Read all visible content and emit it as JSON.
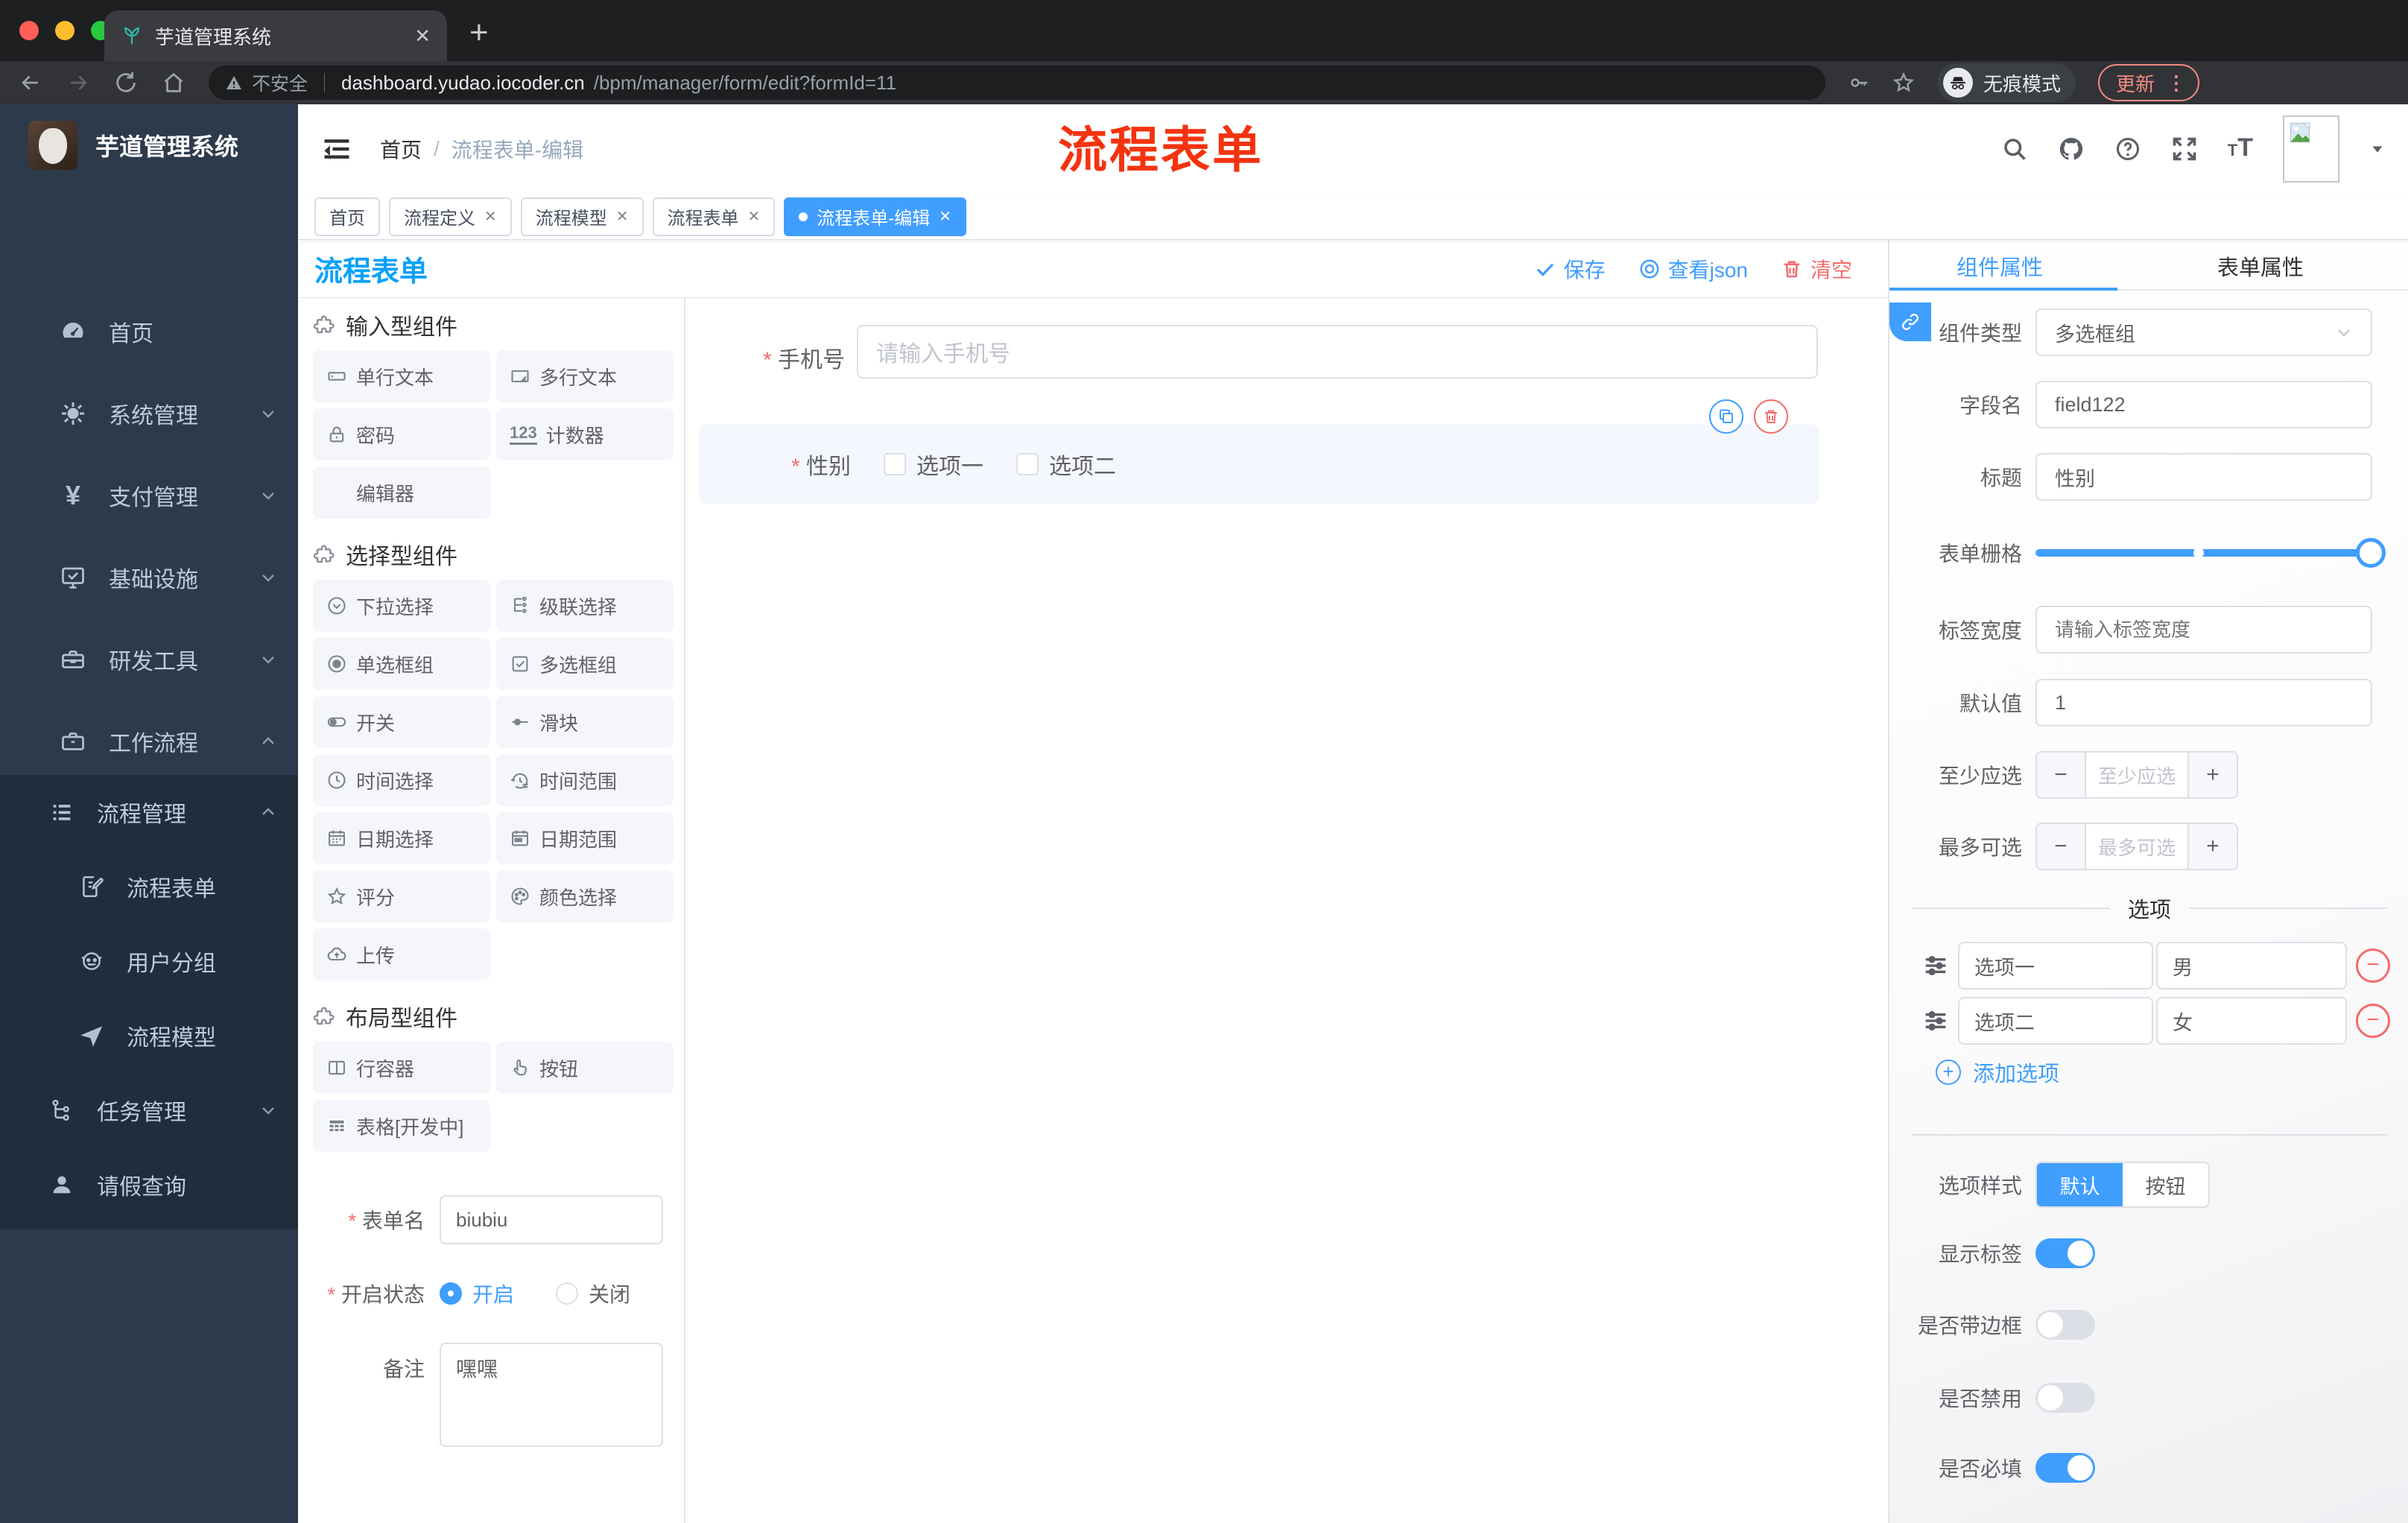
{
  "browser": {
    "tab_title": "芋道管理系统",
    "security_label": "不安全",
    "url_host": "dashboard.yudao.iocoder.cn",
    "url_path": "/bpm/manager/form/edit?formId=11",
    "incognito_label": "无痕模式",
    "update_label": "更新"
  },
  "sidebar": {
    "app_title": "芋道管理系统",
    "items": [
      {
        "label": "首页"
      },
      {
        "label": "系统管理"
      },
      {
        "label": "支付管理"
      },
      {
        "label": "基础设施"
      },
      {
        "label": "研发工具"
      },
      {
        "label": "工作流程"
      }
    ],
    "sub": [
      {
        "label": "流程管理"
      },
      {
        "label": "流程表单"
      },
      {
        "label": "用户分组"
      },
      {
        "label": "流程模型"
      },
      {
        "label": "任务管理"
      },
      {
        "label": "请假查询"
      }
    ]
  },
  "header": {
    "breadcrumb_home": "首页",
    "breadcrumb_sep": "/",
    "breadcrumb_current": "流程表单-编辑",
    "annotation": "流程表单"
  },
  "tags": [
    {
      "label": "首页"
    },
    {
      "label": "流程定义"
    },
    {
      "label": "流程模型"
    },
    {
      "label": "流程表单"
    },
    {
      "label": "流程表单-编辑"
    }
  ],
  "designer": {
    "title": "流程表单",
    "toolbar": {
      "save": "保存",
      "view_json": "查看json",
      "clear": "清空"
    }
  },
  "palette": {
    "sections": [
      {
        "title": "输入型组件",
        "items": [
          {
            "label": "单行文本"
          },
          {
            "label": "多行文本"
          },
          {
            "label": "密码"
          },
          {
            "label": "计数器"
          },
          {
            "label": "编辑器"
          }
        ]
      },
      {
        "title": "选择型组件",
        "items": [
          {
            "label": "下拉选择"
          },
          {
            "label": "级联选择"
          },
          {
            "label": "单选框组"
          },
          {
            "label": "多选框组"
          },
          {
            "label": "开关"
          },
          {
            "label": "滑块"
          },
          {
            "label": "时间选择"
          },
          {
            "label": "时间范围"
          },
          {
            "label": "日期选择"
          },
          {
            "label": "日期范围"
          },
          {
            "label": "评分"
          },
          {
            "label": "颜色选择"
          },
          {
            "label": "上传"
          }
        ]
      },
      {
        "title": "布局型组件",
        "items": [
          {
            "label": "行容器"
          },
          {
            "label": "按钮"
          },
          {
            "label": "表格[开发中]"
          }
        ]
      }
    ],
    "counter_glyph": "123"
  },
  "meta": {
    "form_name_label": "表单名",
    "form_name_value": "biubiu",
    "status_label": "开启状态",
    "status_on": "开启",
    "status_off": "关闭",
    "remark_label": "备注",
    "remark_value": "嘿嘿"
  },
  "canvas": {
    "phone_label": "手机号",
    "phone_placeholder": "请输入手机号",
    "gender_label": "性别",
    "gender_options": [
      "选项一",
      "选项二"
    ]
  },
  "inspector": {
    "tab_component": "组件属性",
    "tab_form": "表单属性",
    "type_label": "组件类型",
    "type_value": "多选框组",
    "field_label": "字段名",
    "field_value": "field122",
    "title_label": "标题",
    "title_value": "性别",
    "grid_label": "表单栅格",
    "labelw_label": "标签宽度",
    "labelw_placeholder": "请输入标签宽度",
    "default_label": "默认值",
    "default_value": "1",
    "min_label": "至少应选",
    "min_placeholder": "至少应选",
    "max_label": "最多可选",
    "max_placeholder": "最多可选",
    "options_title": "选项",
    "options": [
      {
        "label": "选项一",
        "value": "男"
      },
      {
        "label": "选项二",
        "value": "女"
      }
    ],
    "add_option": "添加选项",
    "style_label": "选项样式",
    "style_default": "默认",
    "style_button": "按钮",
    "toggles": [
      {
        "label": "显示标签",
        "on": true
      },
      {
        "label": "是否带边框",
        "on": false
      },
      {
        "label": "是否禁用",
        "on": false
      },
      {
        "label": "是否必填",
        "on": true
      }
    ]
  },
  "colors": {
    "primary": "#409eff",
    "danger": "#f56c6c",
    "designer_title_blue": "#0aa1fa",
    "annotation_red": "#f5330f",
    "sidebar_bg": "#2d3a4b",
    "submenu_bg": "#1f2d3d",
    "chrome_bg": "#1e1f21",
    "palette_item_bg": "#f4f6fc",
    "selected_block_bg": "#f5f7fe"
  }
}
